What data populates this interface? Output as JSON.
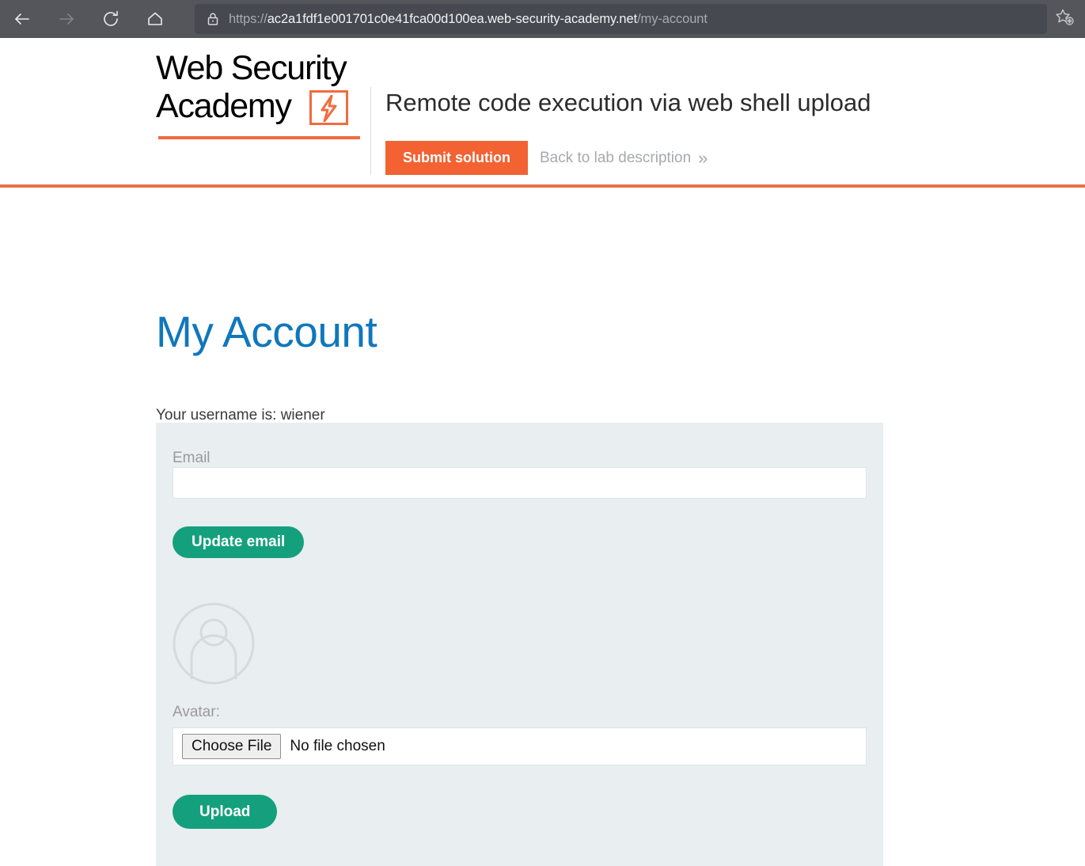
{
  "browser": {
    "nav": {
      "back": "back-arrow",
      "forward": "forward-arrow",
      "reload": "reload",
      "home": "home"
    },
    "url": {
      "scheme": "https://",
      "host": "ac2a1fdf1e001701c0e41fca00d100ea.web-security-academy.net",
      "path": "/my-account",
      "full": "https://ac2a1fdf1e001701c0e41fca00d100ea.web-security-academy.net/my-account",
      "security_icon": "lock-icon"
    },
    "favorite_icon": "star-plus-icon",
    "chrome_bg": "#54565c",
    "url_bg": "#474950"
  },
  "lab": {
    "logo_line1": "Web Security",
    "logo_line2": "Academy",
    "logo_accent": "#f26b3f",
    "title": "Remote code execution via web shell upload",
    "submit_label": "Submit solution",
    "submit_color": "#f26232",
    "back_label": "Back to lab description",
    "back_chevron": "»",
    "rule_color": "#e8714a"
  },
  "account": {
    "heading": "My Account",
    "heading_color": "#1077bc",
    "username_line": "Your username is: wiener"
  },
  "form": {
    "panel_bg": "#e9eef0",
    "email_label": "Email",
    "email_value": "",
    "email_placeholder": "",
    "update_email_label": "Update email",
    "button_color": "#15A07D",
    "avatar_icon": "user-avatar-icon",
    "avatar_label": "Avatar:",
    "choose_file_label": "Choose File",
    "no_file_text": "No file chosen",
    "upload_label": "Upload"
  }
}
